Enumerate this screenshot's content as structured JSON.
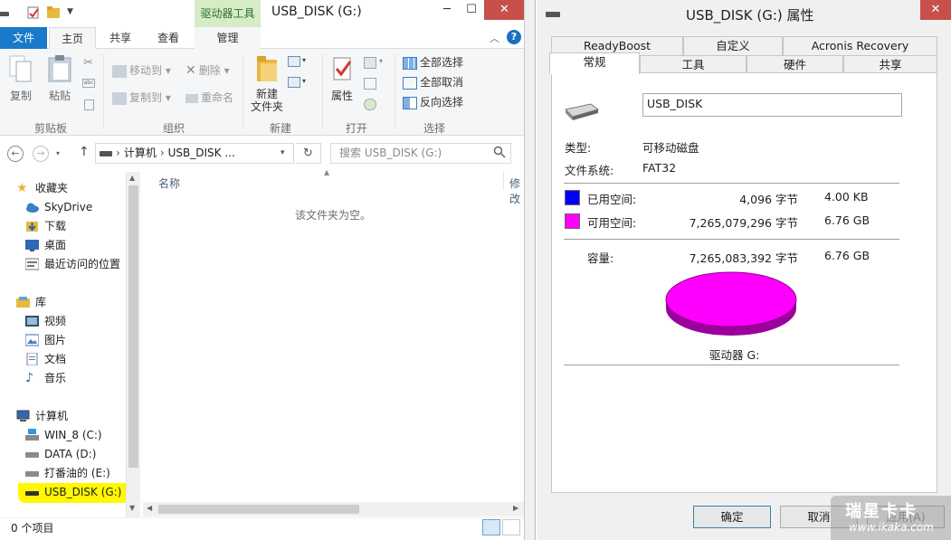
{
  "explorer": {
    "title": "USB_DISK (G:)",
    "context_tab": "驱动器工具",
    "tabs": {
      "file": "文件",
      "home": "主页",
      "share": "共享",
      "view": "查看",
      "manage": "管理"
    },
    "ribbon": {
      "clipboard": {
        "group": "剪贴板",
        "copy": "复制",
        "paste": "粘贴"
      },
      "organize": {
        "group": "组织",
        "move_to": "移动到",
        "copy_to": "复制到",
        "delete": "删除",
        "rename": "重命名"
      },
      "new": {
        "group": "新建",
        "new_folder_l1": "新建",
        "new_folder_l2": "文件夹"
      },
      "open": {
        "group": "打开",
        "properties": "属性"
      },
      "select": {
        "group": "选择",
        "select_all": "全部选择",
        "select_none": "全部取消",
        "invert": "反向选择"
      }
    },
    "address": {
      "path_computer": "计算机",
      "path_sep": "›",
      "path_drive": "USB_DISK ...",
      "search_placeholder": "搜索 USB_DISK (G:)"
    },
    "nav": {
      "favorites": "收藏夹",
      "skydrive": "SkyDrive",
      "downloads": "下载",
      "desktop": "桌面",
      "recent": "最近访问的位置",
      "libraries": "库",
      "videos": "视频",
      "pictures": "图片",
      "documents": "文档",
      "music": "音乐",
      "computer": "计算机",
      "drive_c": "WIN_8 (C:)",
      "drive_d": "DATA (D:)",
      "drive_e": "打番油的 (E:)",
      "drive_g": "USB_DISK (G:)"
    },
    "columns": {
      "name": "名称",
      "modified": "修改"
    },
    "empty_message": "该文件夹为空。",
    "status": "0 个项目"
  },
  "properties": {
    "title": "USB_DISK (G:) 属性",
    "tabs": {
      "readyboost": "ReadyBoost",
      "custom": "自定义",
      "acronis": "Acronis Recovery",
      "general": "常规",
      "tools": "工具",
      "hardware": "硬件",
      "sharing": "共享"
    },
    "volume_label": "USB_DISK",
    "type_label": "类型:",
    "type_value": "可移动磁盘",
    "fs_label": "文件系统:",
    "fs_value": "FAT32",
    "used_label": "已用空间:",
    "used_bytes": "4,096 字节",
    "used_size": "4.00 KB",
    "free_label": "可用空间:",
    "free_bytes": "7,265,079,296 字节",
    "free_size": "6.76 GB",
    "capacity_label": "容量:",
    "capacity_bytes": "7,265,083,392 字节",
    "capacity_size": "6.76 GB",
    "drive_caption": "驱动器 G:",
    "ok": "确定",
    "cancel": "取消",
    "apply": "应用(A)",
    "colors": {
      "used": "#0000ff",
      "free": "#ff00ff",
      "pie_side": "#9c009c"
    }
  },
  "watermark": {
    "brand": "瑞星卡卡",
    "url": "www.ikaka.com"
  }
}
